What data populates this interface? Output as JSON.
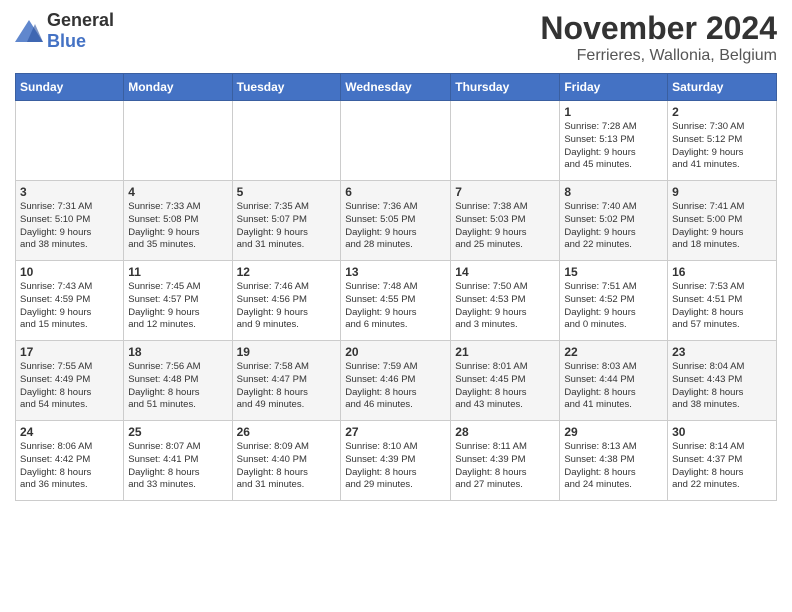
{
  "header": {
    "logo_general": "General",
    "logo_blue": "Blue",
    "title": "November 2024",
    "subtitle": "Ferrieres, Wallonia, Belgium"
  },
  "weekdays": [
    "Sunday",
    "Monday",
    "Tuesday",
    "Wednesday",
    "Thursday",
    "Friday",
    "Saturday"
  ],
  "weeks": [
    [
      {
        "day": "",
        "info": ""
      },
      {
        "day": "",
        "info": ""
      },
      {
        "day": "",
        "info": ""
      },
      {
        "day": "",
        "info": ""
      },
      {
        "day": "",
        "info": ""
      },
      {
        "day": "1",
        "info": "Sunrise: 7:28 AM\nSunset: 5:13 PM\nDaylight: 9 hours\nand 45 minutes."
      },
      {
        "day": "2",
        "info": "Sunrise: 7:30 AM\nSunset: 5:12 PM\nDaylight: 9 hours\nand 41 minutes."
      }
    ],
    [
      {
        "day": "3",
        "info": "Sunrise: 7:31 AM\nSunset: 5:10 PM\nDaylight: 9 hours\nand 38 minutes."
      },
      {
        "day": "4",
        "info": "Sunrise: 7:33 AM\nSunset: 5:08 PM\nDaylight: 9 hours\nand 35 minutes."
      },
      {
        "day": "5",
        "info": "Sunrise: 7:35 AM\nSunset: 5:07 PM\nDaylight: 9 hours\nand 31 minutes."
      },
      {
        "day": "6",
        "info": "Sunrise: 7:36 AM\nSunset: 5:05 PM\nDaylight: 9 hours\nand 28 minutes."
      },
      {
        "day": "7",
        "info": "Sunrise: 7:38 AM\nSunset: 5:03 PM\nDaylight: 9 hours\nand 25 minutes."
      },
      {
        "day": "8",
        "info": "Sunrise: 7:40 AM\nSunset: 5:02 PM\nDaylight: 9 hours\nand 22 minutes."
      },
      {
        "day": "9",
        "info": "Sunrise: 7:41 AM\nSunset: 5:00 PM\nDaylight: 9 hours\nand 18 minutes."
      }
    ],
    [
      {
        "day": "10",
        "info": "Sunrise: 7:43 AM\nSunset: 4:59 PM\nDaylight: 9 hours\nand 15 minutes."
      },
      {
        "day": "11",
        "info": "Sunrise: 7:45 AM\nSunset: 4:57 PM\nDaylight: 9 hours\nand 12 minutes."
      },
      {
        "day": "12",
        "info": "Sunrise: 7:46 AM\nSunset: 4:56 PM\nDaylight: 9 hours\nand 9 minutes."
      },
      {
        "day": "13",
        "info": "Sunrise: 7:48 AM\nSunset: 4:55 PM\nDaylight: 9 hours\nand 6 minutes."
      },
      {
        "day": "14",
        "info": "Sunrise: 7:50 AM\nSunset: 4:53 PM\nDaylight: 9 hours\nand 3 minutes."
      },
      {
        "day": "15",
        "info": "Sunrise: 7:51 AM\nSunset: 4:52 PM\nDaylight: 9 hours\nand 0 minutes."
      },
      {
        "day": "16",
        "info": "Sunrise: 7:53 AM\nSunset: 4:51 PM\nDaylight: 8 hours\nand 57 minutes."
      }
    ],
    [
      {
        "day": "17",
        "info": "Sunrise: 7:55 AM\nSunset: 4:49 PM\nDaylight: 8 hours\nand 54 minutes."
      },
      {
        "day": "18",
        "info": "Sunrise: 7:56 AM\nSunset: 4:48 PM\nDaylight: 8 hours\nand 51 minutes."
      },
      {
        "day": "19",
        "info": "Sunrise: 7:58 AM\nSunset: 4:47 PM\nDaylight: 8 hours\nand 49 minutes."
      },
      {
        "day": "20",
        "info": "Sunrise: 7:59 AM\nSunset: 4:46 PM\nDaylight: 8 hours\nand 46 minutes."
      },
      {
        "day": "21",
        "info": "Sunrise: 8:01 AM\nSunset: 4:45 PM\nDaylight: 8 hours\nand 43 minutes."
      },
      {
        "day": "22",
        "info": "Sunrise: 8:03 AM\nSunset: 4:44 PM\nDaylight: 8 hours\nand 41 minutes."
      },
      {
        "day": "23",
        "info": "Sunrise: 8:04 AM\nSunset: 4:43 PM\nDaylight: 8 hours\nand 38 minutes."
      }
    ],
    [
      {
        "day": "24",
        "info": "Sunrise: 8:06 AM\nSunset: 4:42 PM\nDaylight: 8 hours\nand 36 minutes."
      },
      {
        "day": "25",
        "info": "Sunrise: 8:07 AM\nSunset: 4:41 PM\nDaylight: 8 hours\nand 33 minutes."
      },
      {
        "day": "26",
        "info": "Sunrise: 8:09 AM\nSunset: 4:40 PM\nDaylight: 8 hours\nand 31 minutes."
      },
      {
        "day": "27",
        "info": "Sunrise: 8:10 AM\nSunset: 4:39 PM\nDaylight: 8 hours\nand 29 minutes."
      },
      {
        "day": "28",
        "info": "Sunrise: 8:11 AM\nSunset: 4:39 PM\nDaylight: 8 hours\nand 27 minutes."
      },
      {
        "day": "29",
        "info": "Sunrise: 8:13 AM\nSunset: 4:38 PM\nDaylight: 8 hours\nand 24 minutes."
      },
      {
        "day": "30",
        "info": "Sunrise: 8:14 AM\nSunset: 4:37 PM\nDaylight: 8 hours\nand 22 minutes."
      }
    ]
  ]
}
